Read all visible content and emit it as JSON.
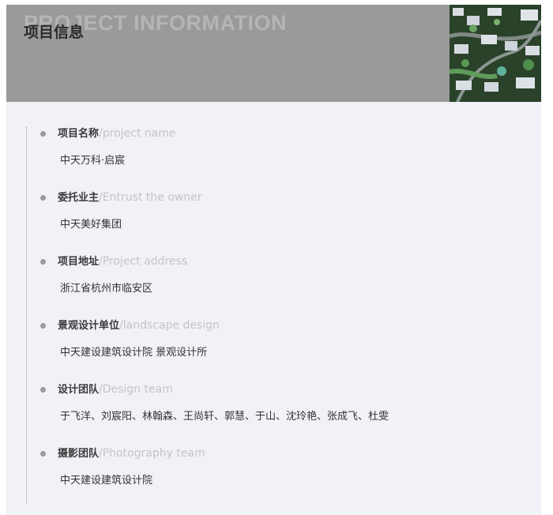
{
  "header": {
    "watermark": "PROJECT INFORMATION",
    "title": "项目信息"
  },
  "items": [
    {
      "label_zh": "项目名称",
      "label_en": "/project name",
      "value": "中天万科·启宸"
    },
    {
      "label_zh": "委托业主",
      "label_en": "/Entrust the owner",
      "value": "中天美好集团"
    },
    {
      "label_zh": "项目地址",
      "label_en": "/Project address",
      "value": "浙江省杭州市临安区"
    },
    {
      "label_zh": "景观设计单位",
      "label_en": "/landscape design",
      "value": "中天建设建筑设计院 景观设计所"
    },
    {
      "label_zh": "设计团队",
      "label_en": "/Design team",
      "value": "于飞洋、刘宸阳、林翰森、王尚轩、郭慧、于山、沈玲艳、张成飞、杜雯"
    },
    {
      "label_zh": "摄影团队",
      "label_en": "/Photography team",
      "value": "中天建设建筑设计院"
    }
  ]
}
